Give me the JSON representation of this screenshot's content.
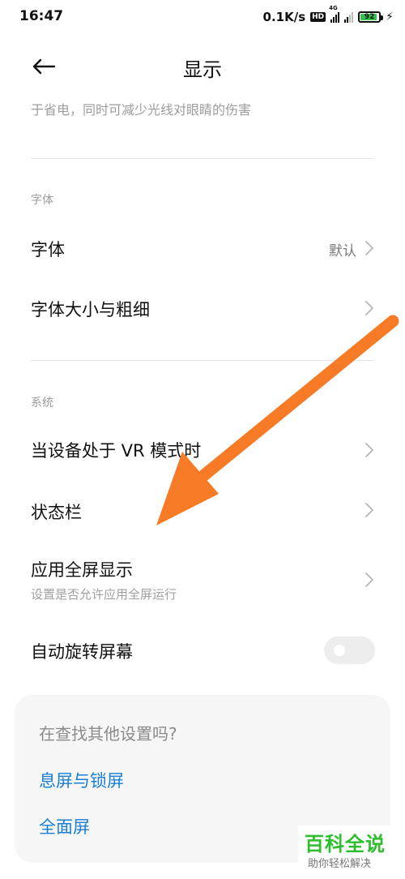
{
  "status_bar": {
    "time": "16:47",
    "speed": "0.1K/s",
    "hd": "HD",
    "network": "4G",
    "battery_level": "92",
    "battery_fraction": 0.92,
    "battery_color": "#33c24d"
  },
  "header": {
    "title": "显示"
  },
  "description": "于省电，同时可减少光线对眼睛的伤害",
  "sections": {
    "font": {
      "label": "字体",
      "items": [
        {
          "title": "字体",
          "value": "默认"
        },
        {
          "title": "字体大小与粗细"
        }
      ]
    },
    "system": {
      "label": "系统",
      "items": [
        {
          "title": "当设备处于 VR 模式时"
        },
        {
          "title": "状态栏"
        },
        {
          "title": "应用全屏显示",
          "subtitle": "设置是否允许应用全屏运行"
        },
        {
          "title": "自动旋转屏幕",
          "toggle": false
        }
      ]
    }
  },
  "search_card": {
    "title": "在查找其他设置吗?",
    "links": [
      "息屏与锁屏",
      "全面屏"
    ]
  },
  "watermark": {
    "main": "百科全说",
    "sub": "助你轻松解决"
  },
  "colors": {
    "link": "#1a7fd4",
    "arrow": "#f77b27",
    "watermark": "#2dbd2d"
  }
}
